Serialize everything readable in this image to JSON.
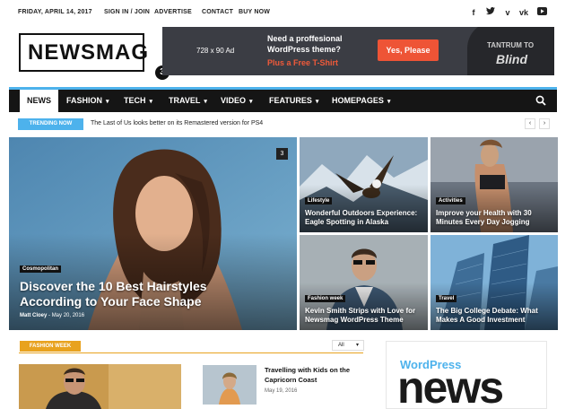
{
  "topbar": {
    "date": "FRIDAY, APRIL 14, 2017",
    "links": [
      "SIGN IN / JOIN",
      "ADVERTISE",
      "CONTACT",
      "BUY NOW"
    ],
    "social": [
      "facebook-icon",
      "twitter-icon",
      "vimeo-icon",
      "vk-icon",
      "youtube-icon"
    ]
  },
  "logo": {
    "text": "NEWSMAG",
    "number": "3"
  },
  "ad": {
    "size": "728 x 90 Ad",
    "line1": "Need a proffesional",
    "line2": "WordPress theme?",
    "line3": "Plus a Free T-Shirt",
    "button": "Yes, Please",
    "shirt_top": "TANTRUM TO",
    "shirt_word": "Blind"
  },
  "nav": {
    "items": [
      {
        "label": "NEWS",
        "active": true
      },
      {
        "label": "FASHION"
      },
      {
        "label": "TECH"
      },
      {
        "label": "TRAVEL"
      },
      {
        "label": "VIDEO"
      },
      {
        "label": "FEATURES"
      },
      {
        "label": "HOMEPAGES"
      }
    ],
    "caret": "▾"
  },
  "trending": {
    "label": "TRENDING NOW",
    "text": "The Last of Us looks better on its Remastered version for PS4",
    "prev": "‹",
    "next": "›"
  },
  "featured": {
    "category": "Cosmopolitan",
    "title": "Discover the 10 Best Hairstyles According to Your Face Shape",
    "author": "Matt Cloey",
    "date": "May 20, 2016",
    "count": "3"
  },
  "tiles": [
    {
      "category": "Lifestyle",
      "title": "Wonderful Outdoors Experience: Eagle Spotting in Alaska"
    },
    {
      "category": "Activities",
      "title": "Improve your Health with 30 Minutes Every Day Jogging"
    },
    {
      "category": "Fashion week",
      "title": "Kevin Smith Strips with Love for Newsmag WordPress Theme"
    },
    {
      "category": "Travel",
      "title": "The Big College Debate: What Makes A Good Investment"
    }
  ],
  "section": {
    "badge": "FASHION WEEK",
    "filter": "All"
  },
  "article2": {
    "title": "Travelling with Kids on the Capricorn Coast",
    "date": "May 19, 2016"
  },
  "sidebar_ad": {
    "top": "WordPress",
    "big": "news"
  },
  "colors": {
    "accent": "#4db2ec",
    "fashion": "#e8a21e",
    "nav": "#151515",
    "ad_button": "#ee5436"
  }
}
